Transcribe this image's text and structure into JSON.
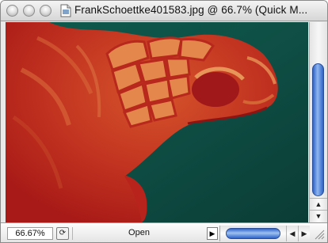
{
  "window": {
    "title": "FrankSchoettke401583.jpg @ 66.7% (Quick M..."
  },
  "icons": {
    "close": "window-close-icon",
    "minimize": "window-minimize-icon",
    "zoom": "window-zoom-icon",
    "document": "document-icon",
    "navigator": "navigator-icon",
    "status_menu": "triangle-right-icon",
    "scroll_left": "arrow-left-icon",
    "scroll_right": "arrow-right-icon",
    "scroll_up": "arrow-up-icon",
    "scroll_down": "arrow-down-icon",
    "resize": "resize-grip-icon"
  },
  "image": {
    "subject": "sea turtle head",
    "mode": "Quick Mask",
    "mask_color": "#c41e18",
    "background_color": "#0e4e43"
  },
  "statusbar": {
    "zoom": "66.67%",
    "info": "Open"
  },
  "colors": {
    "scroll_thumb": "#3b73d6",
    "chrome": "#e9e9e9"
  }
}
